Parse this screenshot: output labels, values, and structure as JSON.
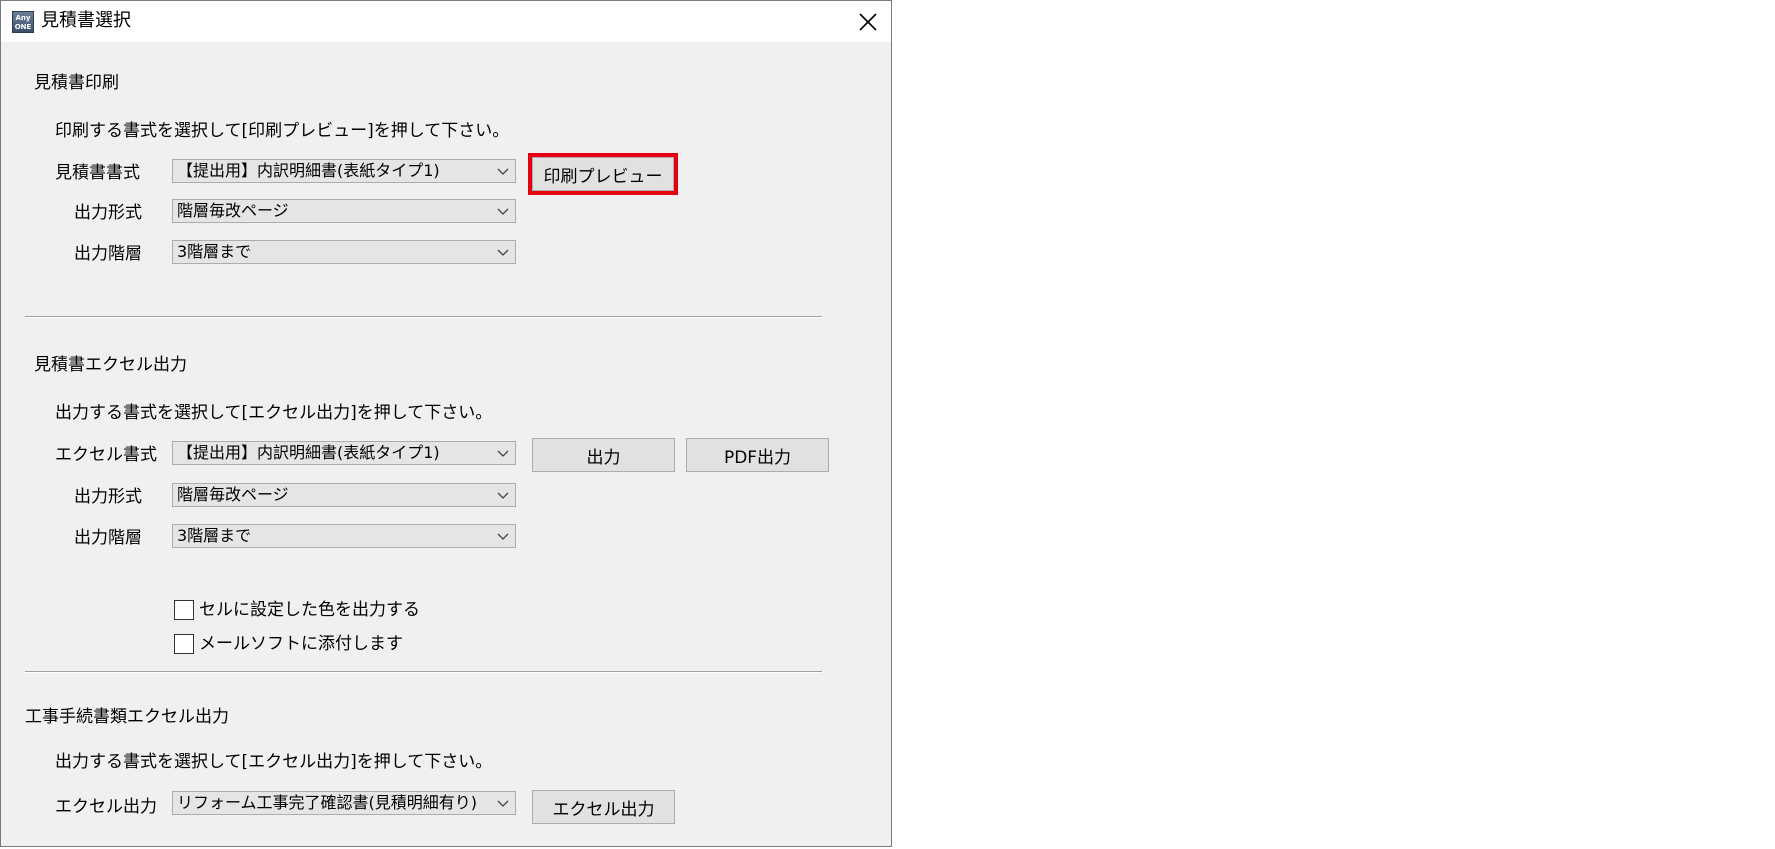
{
  "window": {
    "title": "見積書選択",
    "app_icon_text": "Any ONE"
  },
  "print_section": {
    "title": "見積書印刷",
    "instruction": "印刷する書式を選択して[印刷プレビュー]を押して下さい。",
    "format_label": "見積書書式",
    "format_value": "【提出用】内訳明細書(表紙タイプ1)",
    "output_type_label": "出力形式",
    "output_type_value": "階層毎改ページ",
    "output_level_label": "出力階層",
    "output_level_value": "3階層まで",
    "preview_button": "印刷プレビュー"
  },
  "excel_section": {
    "title": "見積書エクセル出力",
    "instruction": "出力する書式を選択して[エクセル出力]を押して下さい。",
    "format_label": "エクセル書式",
    "format_value": "【提出用】内訳明細書(表紙タイプ1)",
    "output_button": "出力",
    "pdf_button": "PDF出力",
    "output_type_label": "出力形式",
    "output_type_value": "階層毎改ページ",
    "output_level_label": "出力階層",
    "output_level_value": "3階層まで",
    "checkbox_color_label": "セルに設定した色を出力する",
    "checkbox_mail_label": "メールソフトに添付します"
  },
  "construction_section": {
    "title": "工事手続書類エクセル出力",
    "instruction": "出力する書式を選択して[エクセル出力]を押して下さい。",
    "excel_label": "エクセル出力",
    "excel_value": "リフォーム工事完了確認書(見積明細有り)",
    "excel_button": "エクセル出力"
  },
  "colors": {
    "highlight": "#e60012",
    "window_bg": "#f0f0f0"
  }
}
